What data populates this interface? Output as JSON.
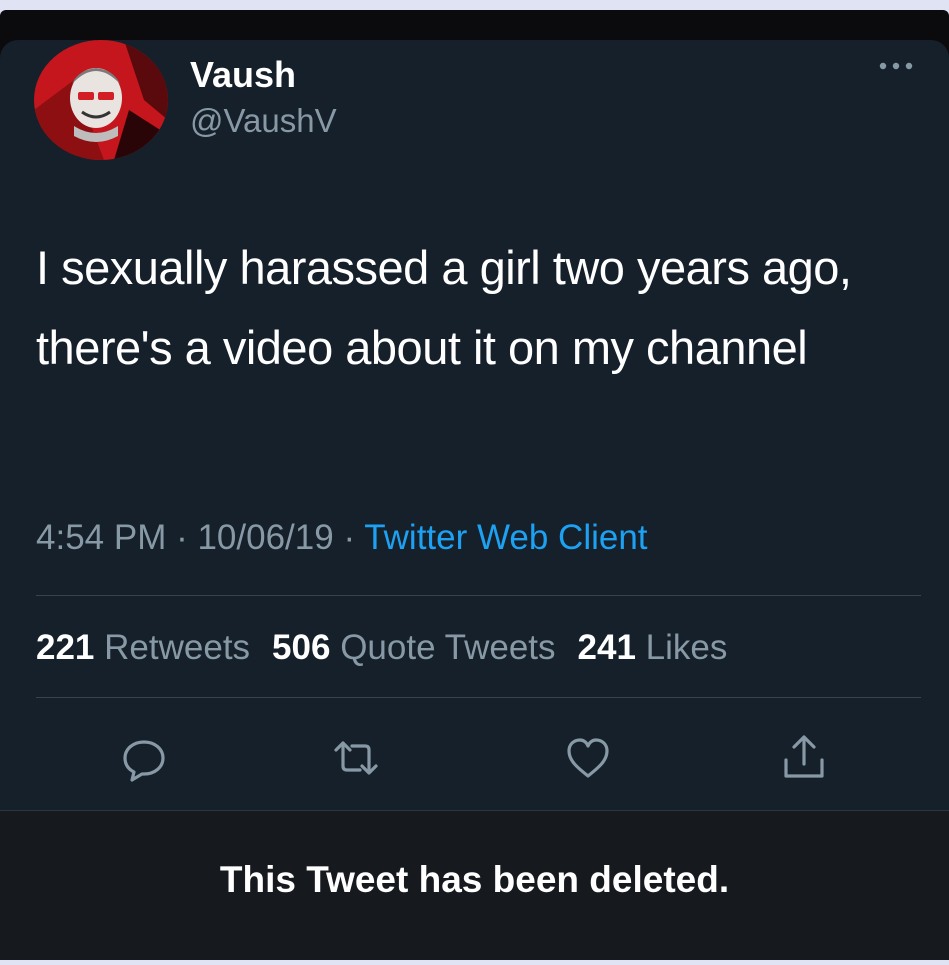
{
  "author": {
    "display_name": "Vaush",
    "handle": "@VaushV"
  },
  "tweet": {
    "text": "I sexually harassed a girl two years ago, there's a video about it on my channel",
    "time": "4:54 PM",
    "date": "10/06/19",
    "separator": " · ",
    "client": "Twitter Web Client"
  },
  "stats": {
    "retweets_count": "221",
    "retweets_label": "Retweets",
    "quotes_count": "506",
    "quotes_label": "Quote Tweets",
    "likes_count": "241",
    "likes_label": "Likes"
  },
  "actions": {
    "icons": [
      "reply-icon",
      "retweet-icon",
      "like-icon",
      "share-icon"
    ]
  },
  "notice": {
    "deleted_text": "This Tweet has been deleted."
  },
  "colors": {
    "background": "#15202b",
    "text_primary": "#ffffff",
    "text_secondary": "#8899a6",
    "accent": "#1da1f2",
    "divider": "#38444d"
  }
}
